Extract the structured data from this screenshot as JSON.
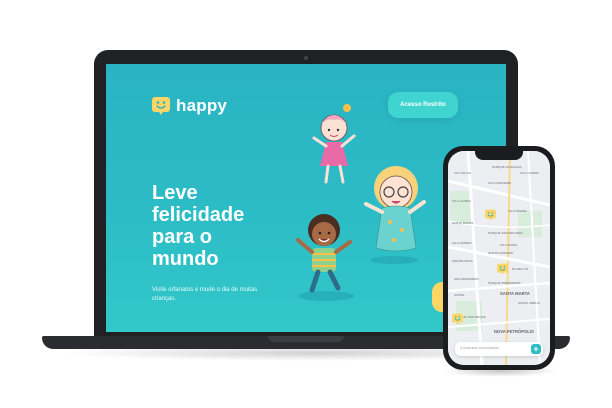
{
  "landing": {
    "logo_text": "happy",
    "restricted_button": "Acesso Restrito",
    "headline_lines": [
      "Leve",
      "felicidade",
      "para o",
      "mundo"
    ],
    "subtitle": "Visite orfanatos e mude o dia de muitas crianças."
  },
  "mobile_map": {
    "labels": [
      "VILA SILVIA",
      "PARQUE DA BALEIA",
      "VILA CARMO",
      "VILA CRUZEIRO",
      "VILA ALPINA",
      "VILA REGINA",
      "SANTA MARTA",
      "PARQUE ANHANGUERA",
      "VILA OSÓRIO",
      "VILA MARIA",
      "SANTO ANTONIO",
      "CIDADE NOVA",
      "PLANALTO",
      "SÃO BERNARDO",
      "PARQUE PRESIDENTE",
      "SAÚDE",
      "SANTA AMÉLIA",
      "NOVA PETRÓPOLIS",
      "PARQUE SÃO ROQUE",
      "ALTO DA SERRA"
    ],
    "big_labels": [
      "SANTA MARTA",
      "NOVA PETRÓPOLIS"
    ],
    "search_placeholder": "3 orfanatos encontrados",
    "add_button": "+"
  },
  "colors": {
    "brand": "#2ab3c3",
    "accent_yellow": "#ffd666",
    "button_aqua": "#3fd4cf"
  },
  "icons": [
    "happy-smile-logo-icon",
    "map-pin-smile-icon",
    "plus-icon"
  ]
}
